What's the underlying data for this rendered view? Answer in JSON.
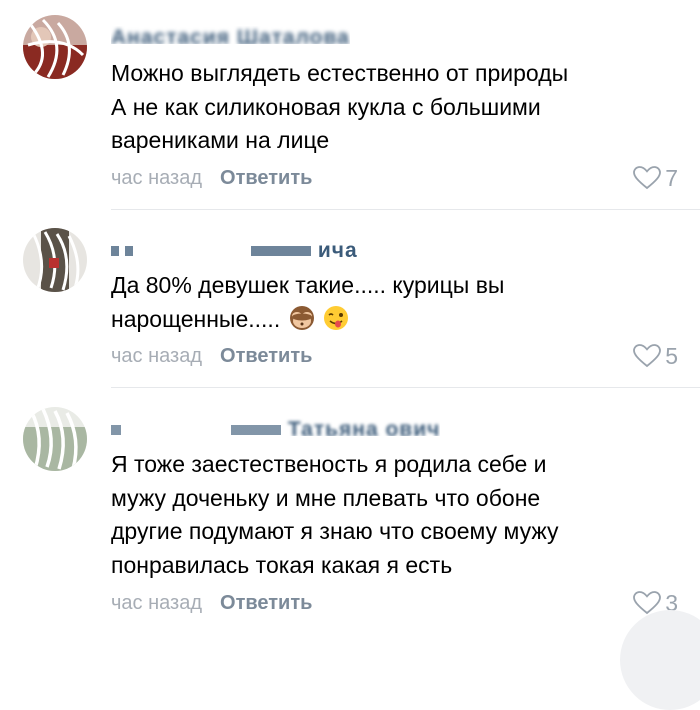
{
  "comments": [
    {
      "author": "Анастасия Шаталова",
      "text_lines": [
        "Можно выглядеть естественно от природы",
        "А не как силиконовая кукла с большими",
        "варениками на лице"
      ],
      "time": "час назад",
      "reply_label": "Ответить",
      "likes": "7",
      "like_icon": "heart-outline-icon"
    },
    {
      "author": "ичa",
      "text_lines": [
        "Да 80% девушек такие..... курицы вы",
        "нарощенные....."
      ],
      "emojis": [
        "see-no-evil-monkey-emoji",
        "winking-face-tongue-emoji"
      ],
      "time": "час назад",
      "reply_label": "Ответить",
      "likes": "5",
      "like_icon": "heart-outline-icon"
    },
    {
      "author": "Татьяна ович",
      "text_lines": [
        "Я тоже заестественость я родила себе и",
        "мужу доченьку и мне плевать что обоне",
        "другие подумают я знаю что своему мужу",
        "понравилась токая какая я есть"
      ],
      "time": "час назад",
      "reply_label": "Ответить",
      "likes": "3",
      "like_icon": "heart-outline-icon"
    }
  ],
  "colors": {
    "author": "#2f4f6f",
    "meta_time": "#a7adb5",
    "reply": "#7c8a99",
    "likes": "#9aa3ad",
    "divider": "#e6e8eb"
  }
}
